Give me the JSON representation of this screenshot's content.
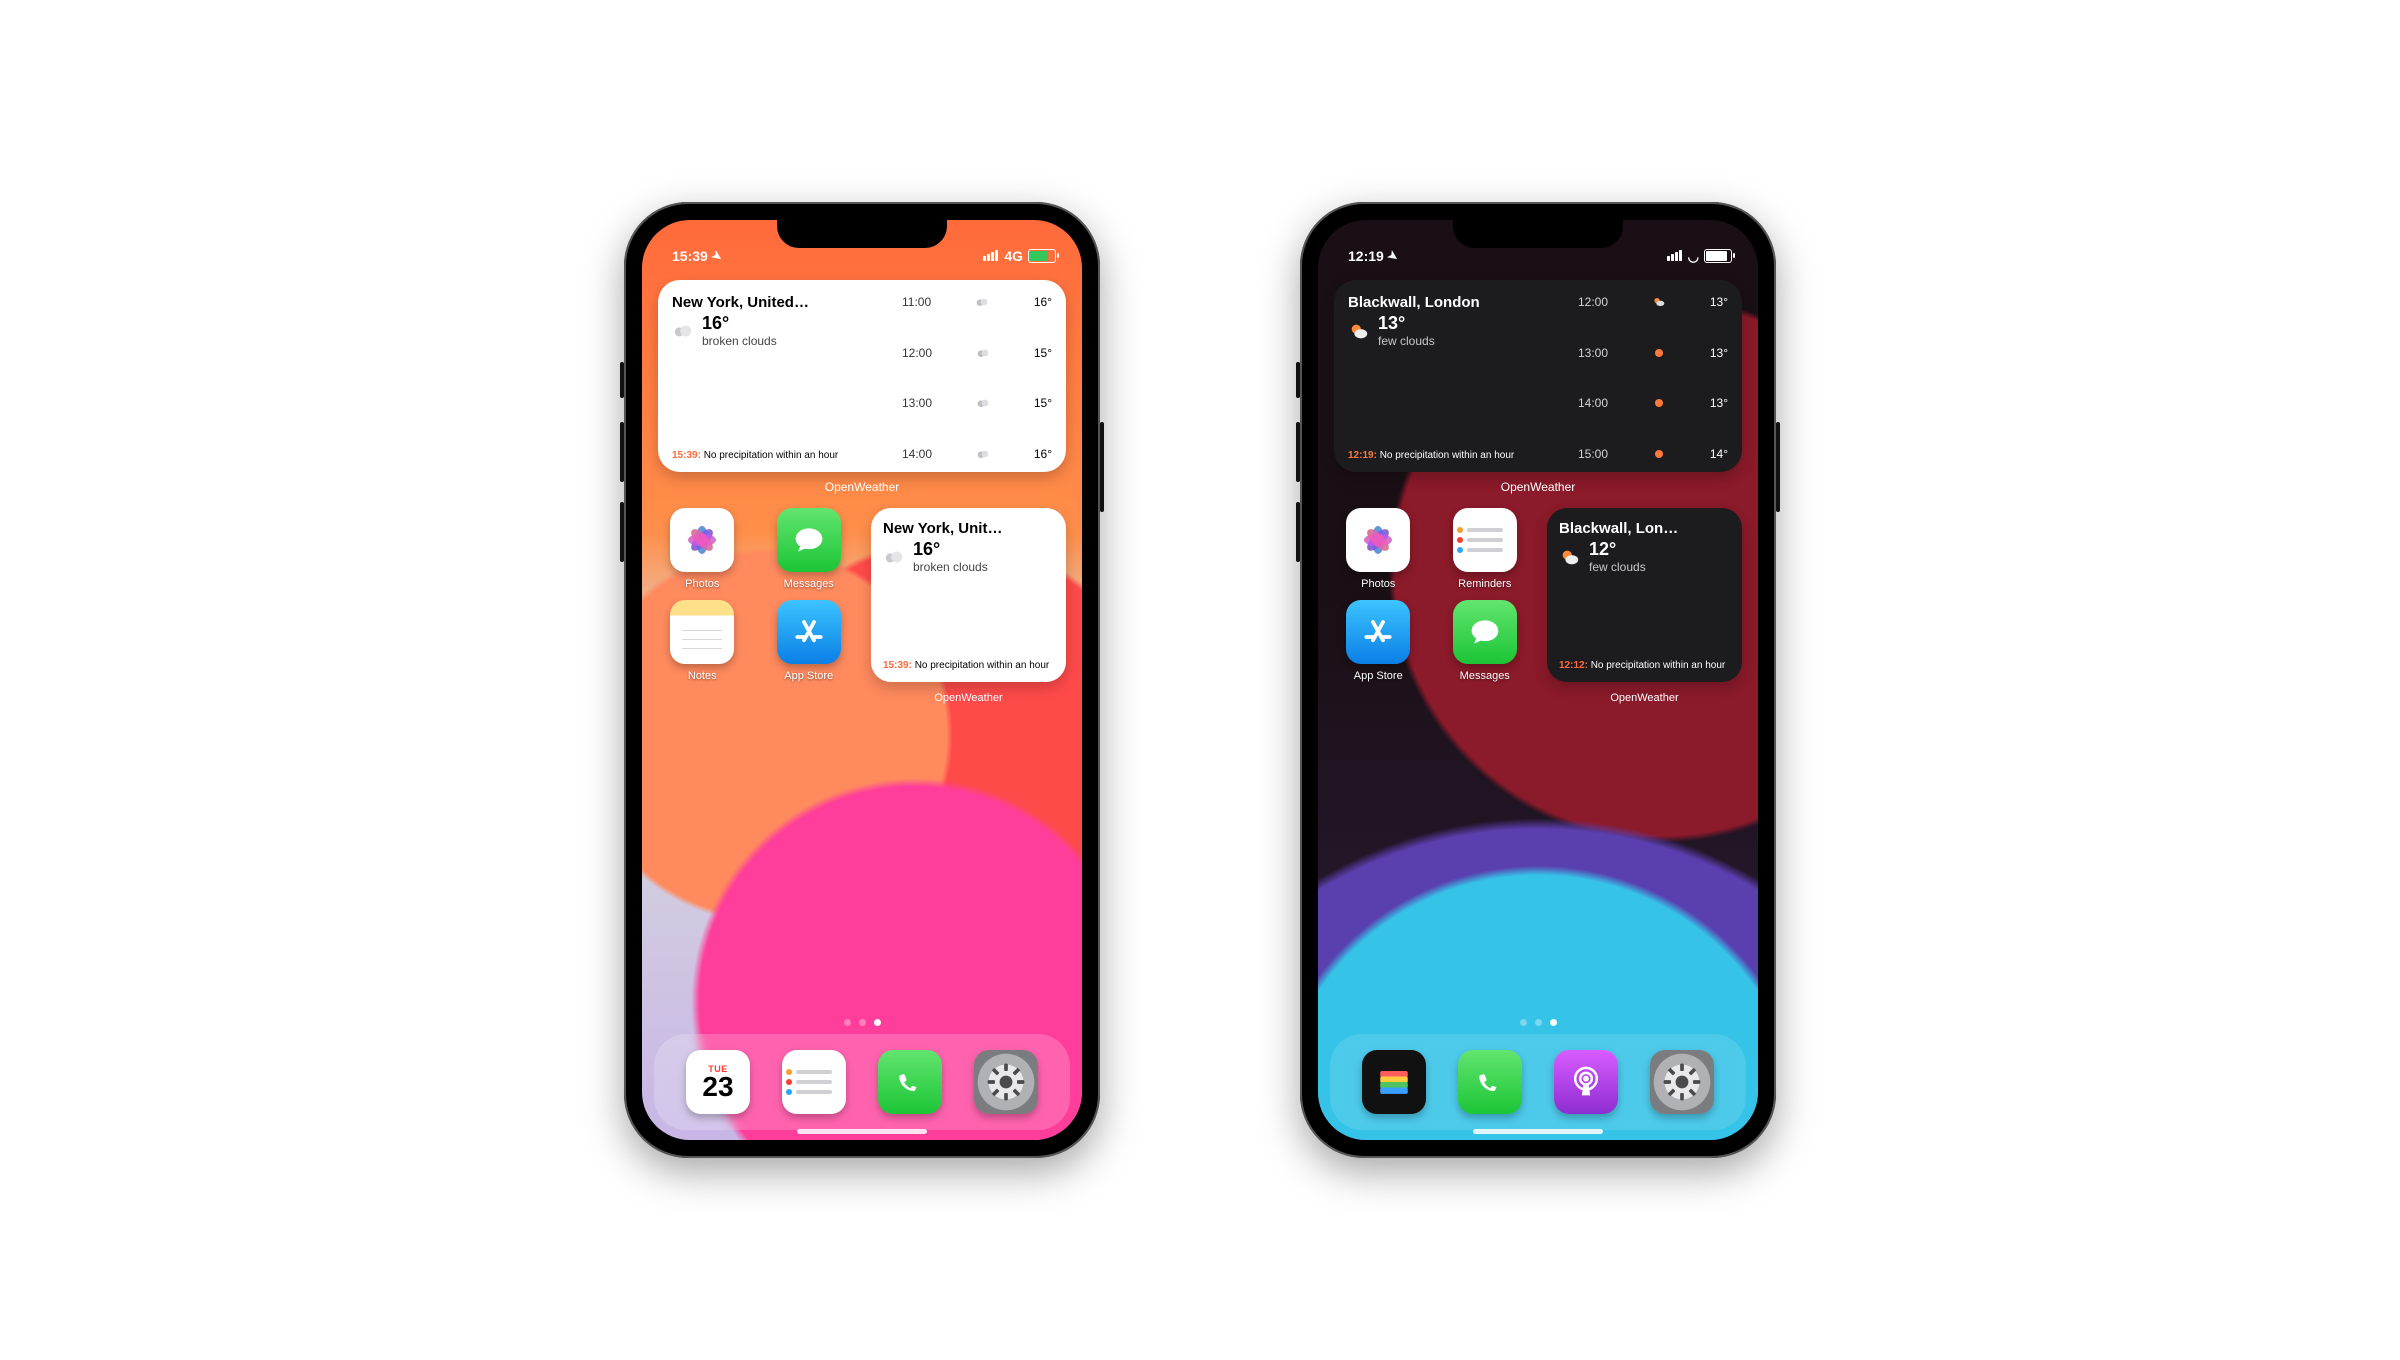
{
  "phones": {
    "light": {
      "status": {
        "time": "15:39",
        "network": "4G",
        "signal": 4,
        "wifi": false,
        "battery_pct": 70,
        "battery_color": "green"
      },
      "widget_medium": {
        "location": "New York, United…",
        "temp": "16°",
        "desc": "broken clouds",
        "note_time": "15:39:",
        "note_text": "No precipitation within an hour",
        "forecast": [
          {
            "t": "11:00",
            "ic": "broken",
            "v": "16°"
          },
          {
            "t": "12:00",
            "ic": "broken",
            "v": "15°"
          },
          {
            "t": "13:00",
            "ic": "broken",
            "v": "15°"
          },
          {
            "t": "14:00",
            "ic": "broken",
            "v": "16°"
          }
        ],
        "label": "OpenWeather"
      },
      "apps_row1": [
        {
          "name": "Photos",
          "kind": "photos"
        },
        {
          "name": "Messages",
          "kind": "messages"
        }
      ],
      "apps_row2": [
        {
          "name": "Notes",
          "kind": "notes"
        },
        {
          "name": "App Store",
          "kind": "appstore"
        }
      ],
      "widget_small": {
        "location": "New York, Unit…",
        "temp": "16°",
        "desc": "broken clouds",
        "note_time": "15:39:",
        "note_text": "No precipitation within an hour",
        "label": "OpenWeather"
      },
      "pages": {
        "total": 3,
        "active": 2
      },
      "dock": [
        {
          "kind": "cal",
          "day": "TUE",
          "date": "23"
        },
        {
          "kind": "reminders"
        },
        {
          "kind": "phone"
        },
        {
          "kind": "settings"
        }
      ]
    },
    "dark": {
      "status": {
        "time": "12:19",
        "network": "",
        "signal": 4,
        "wifi": true,
        "battery_pct": 82,
        "battery_color": "white"
      },
      "widget_medium": {
        "location": "Blackwall, London",
        "temp": "13°",
        "desc": "few clouds",
        "note_time": "12:19:",
        "note_text": "No precipitation within an hour",
        "forecast": [
          {
            "t": "12:00",
            "ic": "few",
            "v": "13°"
          },
          {
            "t": "13:00",
            "ic": "sun",
            "v": "13°"
          },
          {
            "t": "14:00",
            "ic": "sun",
            "v": "13°"
          },
          {
            "t": "15:00",
            "ic": "sun",
            "v": "14°"
          }
        ],
        "label": "OpenWeather"
      },
      "apps_row1": [
        {
          "name": "Photos",
          "kind": "photos"
        },
        {
          "name": "Reminders",
          "kind": "reminders"
        }
      ],
      "apps_row2": [
        {
          "name": "App Store",
          "kind": "appstore"
        },
        {
          "name": "Messages",
          "kind": "messages"
        }
      ],
      "widget_small": {
        "location": "Blackwall, Lon…",
        "temp": "12°",
        "desc": "few clouds",
        "note_time": "12:12:",
        "note_text": "No precipitation within an hour",
        "label": "OpenWeather"
      },
      "pages": {
        "total": 3,
        "active": 2
      },
      "dock": [
        {
          "kind": "wallet"
        },
        {
          "kind": "phone"
        },
        {
          "kind": "podcasts"
        },
        {
          "kind": "settings"
        }
      ]
    }
  }
}
